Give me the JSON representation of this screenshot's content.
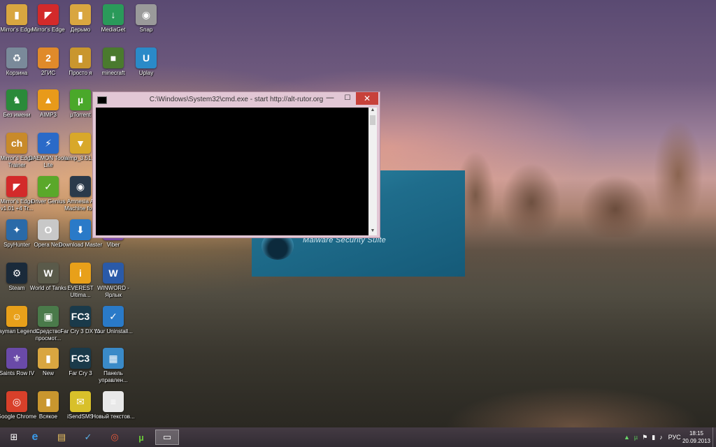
{
  "desktop_icons": [
    {
      "label": "Mirror's Edge",
      "glyph": "▮",
      "color": "#d9a640",
      "icon": "folder-icon"
    },
    {
      "label": "Mirror's Edge",
      "glyph": "◤",
      "color": "#d32a2a",
      "icon": "mirrors-edge-icon"
    },
    {
      "label": "Дерьмо",
      "glyph": "▮",
      "color": "#d9a640",
      "icon": "folder-icon"
    },
    {
      "label": "MediaGet",
      "glyph": "↓",
      "color": "#2a9a5a",
      "icon": "mediaget-icon"
    },
    {
      "label": "Snap",
      "glyph": "◉",
      "color": "#9a9a9a",
      "icon": "camera-icon"
    },
    {
      "label": "Корзина",
      "glyph": "♻",
      "color": "#7a8a9a",
      "icon": "recycle-bin-icon"
    },
    {
      "label": "2ГИС",
      "glyph": "2",
      "color": "#e08a2a",
      "icon": "2gis-icon"
    },
    {
      "label": "Просто я",
      "glyph": "▮",
      "color": "#c9962e",
      "icon": "folder-icon"
    },
    {
      "label": "minecraft",
      "glyph": "■",
      "color": "#4a7a2e",
      "icon": "minecraft-icon"
    },
    {
      "label": "Uplay",
      "glyph": "U",
      "color": "#2a8ac8",
      "icon": "uplay-icon"
    },
    {
      "label": "Без имени",
      "glyph": "♞",
      "color": "#2a8a3a",
      "icon": "game-icon"
    },
    {
      "label": "AIMP3",
      "glyph": "▲",
      "color": "#e89a1a",
      "icon": "aimp-icon"
    },
    {
      "label": "µTorrent",
      "glyph": "µ",
      "color": "#4aa82a",
      "icon": "utorrent-icon"
    },
    {
      "label": "Mirror's Edge Trainer",
      "glyph": "ch",
      "color": "#c88a2a",
      "icon": "trainer-icon"
    },
    {
      "label": "DAEMON Tools Lite",
      "glyph": "⚡",
      "color": "#2a6ac8",
      "icon": "daemon-tools-icon"
    },
    {
      "label": "aimp_3.51...",
      "glyph": "▼",
      "color": "#d8a82a",
      "icon": "installer-icon"
    },
    {
      "label": "Mirror's Edge v1.01 +4 Tr...",
      "glyph": "◤",
      "color": "#d32a2a",
      "icon": "mirrors-edge-icon"
    },
    {
      "label": "Driver Genius",
      "glyph": "✓",
      "color": "#5aa82a",
      "icon": "driver-genius-icon"
    },
    {
      "label": "Amnesia A Machine fo...",
      "glyph": "◉",
      "color": "#2a3a4a",
      "icon": "amnesia-icon"
    },
    {
      "label": "SpyHunter",
      "glyph": "✦",
      "color": "#2a6aa8",
      "icon": "spyhunter-icon"
    },
    {
      "label": "Opera Next",
      "glyph": "O",
      "color": "#c8c8c8",
      "icon": "opera-icon"
    },
    {
      "label": "Download Master",
      "glyph": "⬇",
      "color": "#2a7ac8",
      "icon": "download-master-icon"
    },
    {
      "label": "Viber",
      "glyph": "✆",
      "color": "#7a4aa8",
      "icon": "viber-icon"
    },
    {
      "label": "Steam",
      "glyph": "⚙",
      "color": "#1a2a3a",
      "icon": "steam-icon"
    },
    {
      "label": "World of Tanks",
      "glyph": "W",
      "color": "#5a5a4a",
      "icon": "world-of-tanks-icon"
    },
    {
      "label": "EVEREST Ultima...",
      "glyph": "i",
      "color": "#e8a01a",
      "icon": "everest-icon"
    },
    {
      "label": "WINWORD - Ярлык",
      "glyph": "W",
      "color": "#2a5aa8",
      "icon": "word-icon"
    },
    {
      "label": "Rayman Legends",
      "glyph": "☺",
      "color": "#e8a01a",
      "icon": "rayman-icon"
    },
    {
      "label": "Средство просмот...",
      "glyph": "▣",
      "color": "#4a7a4a",
      "icon": "viewer-icon"
    },
    {
      "label": "Far Cry 3 DX 11",
      "glyph": "FC3",
      "color": "#1a3a4a",
      "icon": "far-cry-icon"
    },
    {
      "label": "Your Uninstall...",
      "glyph": "✓",
      "color": "#2a7ac8",
      "icon": "uninstaller-icon"
    },
    {
      "label": "Saints Row IV",
      "glyph": "⚜",
      "color": "#6a4aa8",
      "icon": "saints-row-icon"
    },
    {
      "label": "New",
      "glyph": "▮",
      "color": "#d9a640",
      "icon": "folder-icon"
    },
    {
      "label": "Far Cry 3",
      "glyph": "FC3",
      "color": "#1a3a4a",
      "icon": "far-cry-icon"
    },
    {
      "label": "Панель управлен...",
      "glyph": "▦",
      "color": "#3a8ac8",
      "icon": "control-panel-icon"
    },
    {
      "label": "Google Chrome",
      "glyph": "◎",
      "color": "#d8402a",
      "icon": "chrome-icon"
    },
    {
      "label": "Всякое",
      "glyph": "▮",
      "color": "#c9962e",
      "icon": "folder-icon"
    },
    {
      "label": "iSendSMS",
      "glyph": "✉",
      "color": "#d8c02a",
      "icon": "isendsms-icon"
    },
    {
      "label": "Новый текстов...",
      "glyph": "≡",
      "color": "#e8e8e8",
      "icon": "text-file-icon"
    }
  ],
  "popup": {
    "text": "Malware Security Suite"
  },
  "cmd": {
    "title": "C:\\Windows\\System32\\cmd.exe - start  http://alt-rutor.org",
    "minimize": "—",
    "maximize": "☐",
    "close": "✕",
    "scroll_up": "▲",
    "scroll_down": "▼"
  },
  "taskbar": {
    "start": "⊞",
    "ie": "e",
    "explorer": "▤",
    "uninstaller": "✓",
    "chrome": "◎",
    "utorrent": "µ",
    "cmd": "▭"
  },
  "tray": {
    "language": "РУС",
    "time": "18:15",
    "date": "20.09.2013"
  }
}
